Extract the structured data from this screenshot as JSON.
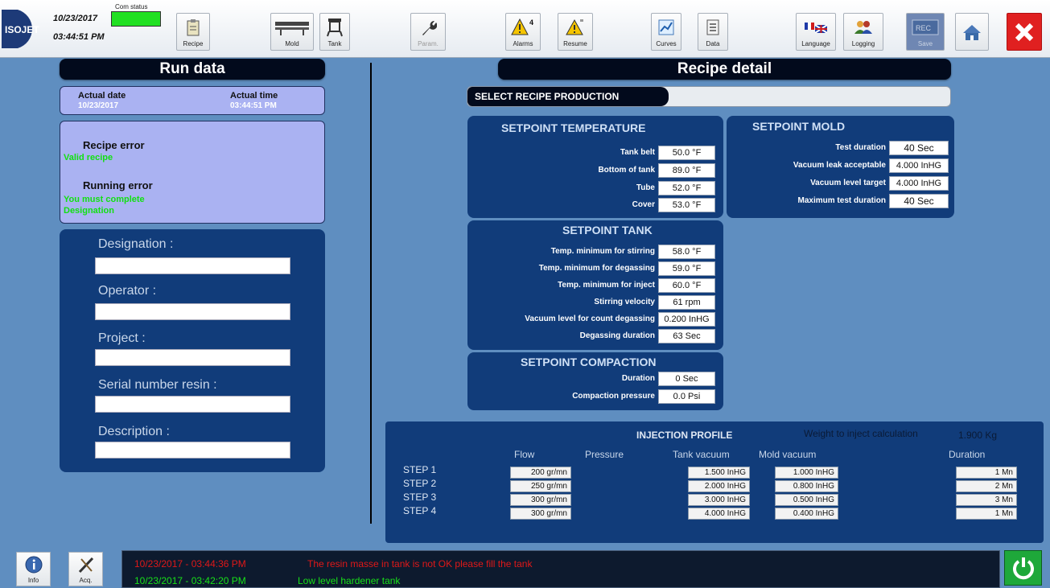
{
  "header": {
    "logo_text": "ISOJET",
    "date": "10/23/2017",
    "time": "03:44:51 PM",
    "com_status_label": "Com status",
    "com_status_color": "#22e022"
  },
  "toolbar": {
    "recipe": "Recipe",
    "mold": "Mold",
    "tank": "Tank",
    "param": "Param.",
    "alarms": "Alarms",
    "alarms_count": "4",
    "resume": "Resume",
    "curves": "Curves",
    "data": "Data",
    "language": "Language",
    "logging": "Logging",
    "save": "Save",
    "save_icon_text": "REC"
  },
  "run_data": {
    "title": "Run data",
    "actual_date_label": "Actual date",
    "actual_date": "10/23/2017",
    "actual_time_label": "Actual time",
    "actual_time": "03:44:51 PM",
    "recipe_error_label": "Recipe error",
    "recipe_error_value": "Valid recipe",
    "running_error_label": "Running error",
    "running_error_value_1": "You must complete",
    "running_error_value_2": "Designation",
    "designation_label": "Designation :",
    "designation_value": "",
    "operator_label": "Operator :",
    "operator_value": "",
    "project_label": "Project :",
    "project_value": "",
    "serial_label": "Serial number resin :",
    "serial_value": "",
    "description_label": "Description :",
    "description_value": ""
  },
  "recipe_detail": {
    "title": "Recipe detail",
    "select_label": "SELECT RECIPE PRODUCTION",
    "select_value": "",
    "temperature": {
      "title": "SETPOINT TEMPERATURE",
      "rows": [
        {
          "label": "Tank belt",
          "value": "50.0 °F"
        },
        {
          "label": "Bottom of tank",
          "value": "89.0 °F"
        },
        {
          "label": "Tube",
          "value": "52.0 °F"
        },
        {
          "label": "Cover",
          "value": "53.0 °F"
        }
      ]
    },
    "mold": {
      "title": "SETPOINT MOLD",
      "rows": [
        {
          "label": "Test duration",
          "value": "40 Sec"
        },
        {
          "label": "Vacuum leak acceptable",
          "value": "4.000 InHG"
        },
        {
          "label": "Vacuum level target",
          "value": "4.000 InHG"
        },
        {
          "label": "Maximum test duration",
          "value": "40 Sec"
        }
      ]
    },
    "tank": {
      "title": "SETPOINT TANK",
      "rows": [
        {
          "label": "Temp. minimum for stirring",
          "value": "58.0 °F"
        },
        {
          "label": "Temp. minimum for degassing",
          "value": "59.0 °F"
        },
        {
          "label": "Temp. minimum for inject",
          "value": "60.0 °F"
        },
        {
          "label": "Stirring velocity",
          "value": "61 rpm"
        },
        {
          "label": "Vacuum level for count degassing",
          "value": "0.200 InHG"
        },
        {
          "label": "Degassing duration",
          "value": "63 Sec"
        }
      ]
    },
    "compaction": {
      "title": "SETPOINT COMPACTION",
      "rows": [
        {
          "label": "Duration",
          "value": "0 Sec"
        },
        {
          "label": "Compaction pressure",
          "value": "0.0 Psi"
        }
      ]
    }
  },
  "injection": {
    "title": "INJECTION PROFILE",
    "weight_label": "Weight to inject calculation",
    "weight_value": "1.900 Kg",
    "headers": {
      "flow": "Flow",
      "pressure": "Pressure",
      "tank_vacuum": "Tank vacuum",
      "mold_vacuum": "Mold vacuum",
      "duration": "Duration"
    },
    "steps": [
      {
        "name": "STEP 1",
        "flow": "200 gr/mn",
        "tank_vacuum": "1.500 InHG",
        "mold_vacuum": "1.000 InHG",
        "duration": "1 Mn"
      },
      {
        "name": "STEP 2",
        "flow": "250 gr/mn",
        "tank_vacuum": "2.000 InHG",
        "mold_vacuum": "0.800 InHG",
        "duration": "2 Mn"
      },
      {
        "name": "STEP 3",
        "flow": "300 gr/mn",
        "tank_vacuum": "3.000 InHG",
        "mold_vacuum": "0.500 InHG",
        "duration": "3 Mn"
      },
      {
        "name": "STEP 4",
        "flow": "300 gr/mn",
        "tank_vacuum": "4.000 InHG",
        "mold_vacuum": "0.400 InHG",
        "duration": "1 Mn"
      }
    ]
  },
  "statusbar": {
    "info": "Info",
    "acq": "Acq.",
    "log": [
      {
        "time": "10/23/2017 - 03:44:36 PM",
        "message": "The resin masse in tank  is not OK please fill the tank",
        "color": "#e01818"
      },
      {
        "time": "10/23/2017 - 03:42:20 PM",
        "message": "Low level hardener tank",
        "color": "#18e018"
      }
    ]
  }
}
